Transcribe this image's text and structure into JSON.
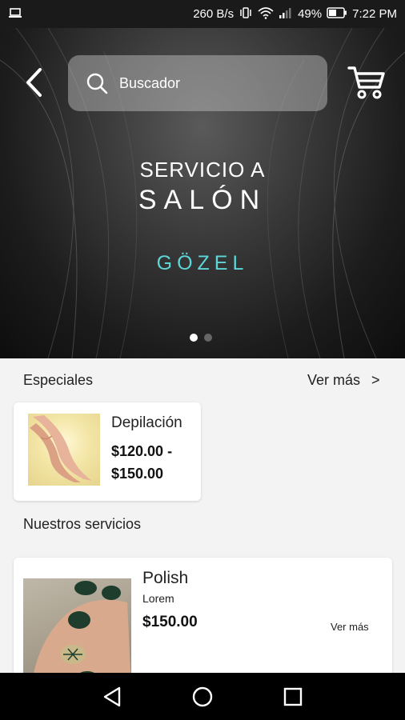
{
  "status_bar": {
    "speed": "260 B/s",
    "battery": "49%",
    "time": "7:22 PM"
  },
  "search": {
    "placeholder": "Buscador"
  },
  "hero": {
    "title_line1": "SERVICIO A",
    "title_line2": "SALÓN",
    "brand": "GÖZEL",
    "slides": 2,
    "active_slide": 1
  },
  "specials": {
    "label": "Especiales",
    "see_more": "Ver más",
    "see_more_chevron": ">",
    "items": [
      {
        "name": "Depilación",
        "price_line1": "$120.00 -",
        "price_line2": "$150.00"
      }
    ]
  },
  "services": {
    "label": "Nuestros servicios",
    "items": [
      {
        "name": "Polish",
        "description": "Lorem",
        "price": "$150.00",
        "see_more": "Ver más"
      }
    ]
  },
  "colors": {
    "brand_accent": "#5dd6d8",
    "status_bar": "#1a1a1a",
    "nav_bar": "#000000",
    "background": "#f3f3f3"
  },
  "icons": {
    "back": "chevron-left-icon",
    "search": "search-icon",
    "cart": "cart-icon",
    "nav_back": "triangle-back-icon",
    "nav_home": "circle-home-icon",
    "nav_recents": "square-recents-icon"
  }
}
